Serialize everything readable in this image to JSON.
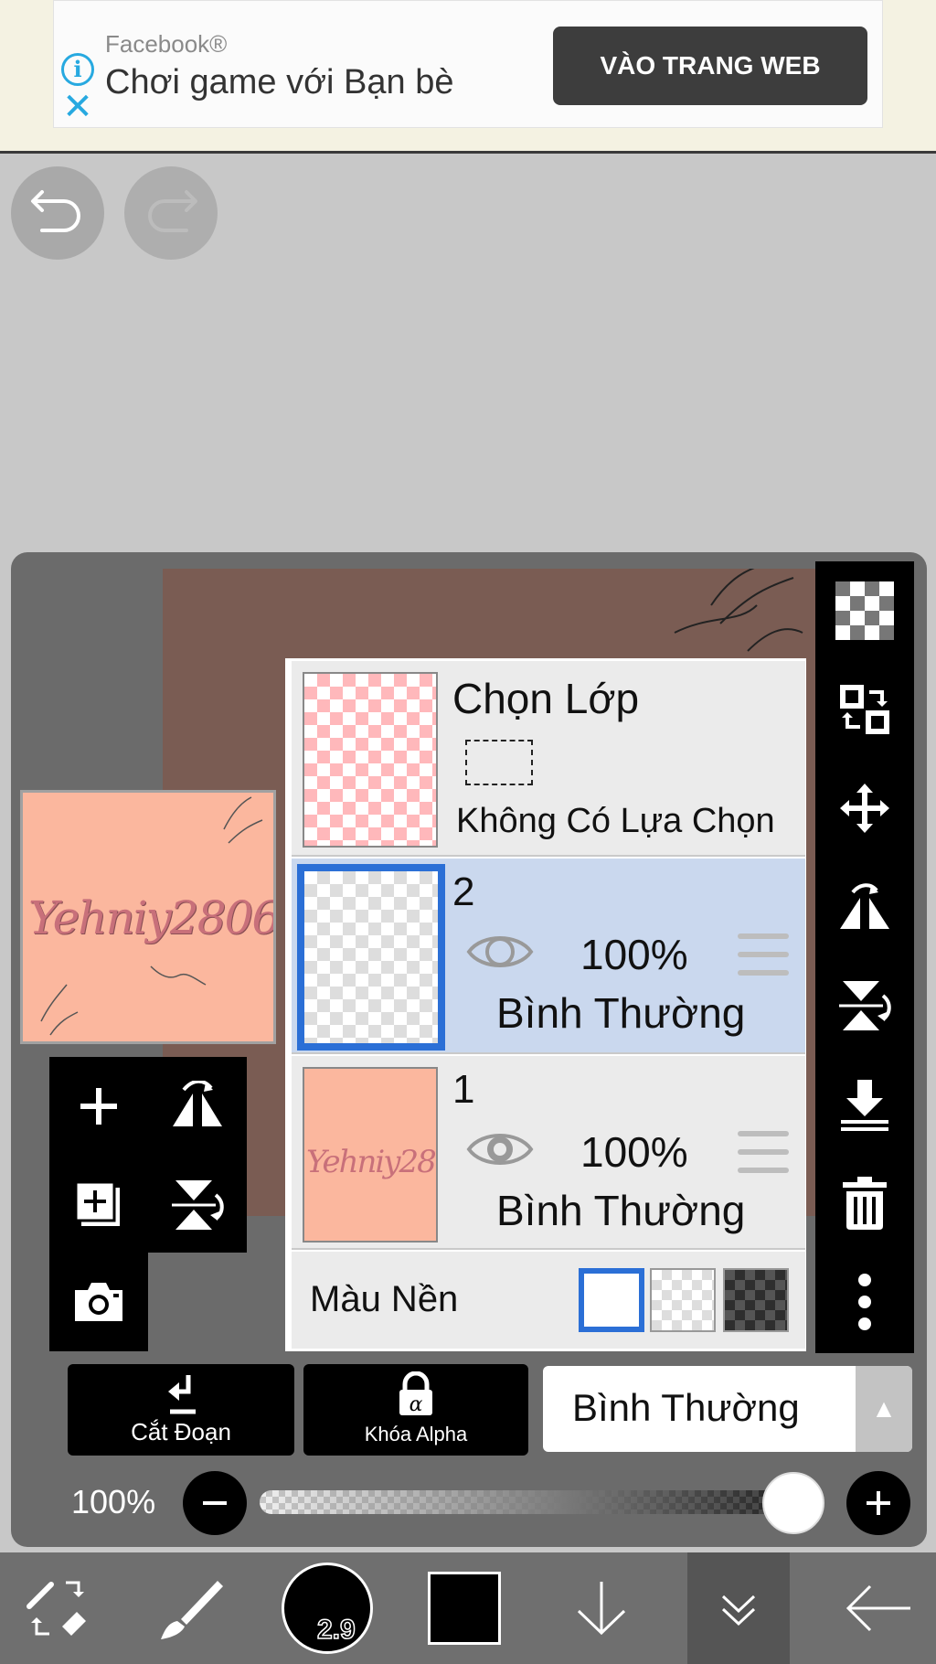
{
  "ad": {
    "source": "Facebook®",
    "title": "Chơi game với Bạn bè",
    "cta": "VÀO TRANG WEB"
  },
  "preview": {
    "text": "Yehniy2806"
  },
  "layers": {
    "selection": {
      "title": "Chọn Lớp",
      "subtitle": "Không Có Lựa Chọn"
    },
    "items": [
      {
        "number": "2",
        "opacity": "100%",
        "blend": "Bình Thường",
        "selected": true,
        "visible": true
      },
      {
        "number": "1",
        "opacity": "100%",
        "blend": "Bình Thường",
        "selected": false,
        "visible": true
      }
    ],
    "background": {
      "label": "Màu Nền",
      "options": [
        "white",
        "transparent",
        "dark"
      ],
      "selected": "white"
    }
  },
  "actions": {
    "clip_label": "Cắt Đoạn",
    "alpha_lock_label": "Khóa Alpha",
    "blend_mode": "Bình Thường"
  },
  "opacity": {
    "label": "100%",
    "value": 1.0
  },
  "toolbar": {
    "brush_size": "2.9",
    "color": "#000000"
  },
  "colors": {
    "accent": "#2b6fd6",
    "selected_row": "#cad8ee",
    "canvas": "#7a5c53",
    "peach": "#fbb79e"
  }
}
